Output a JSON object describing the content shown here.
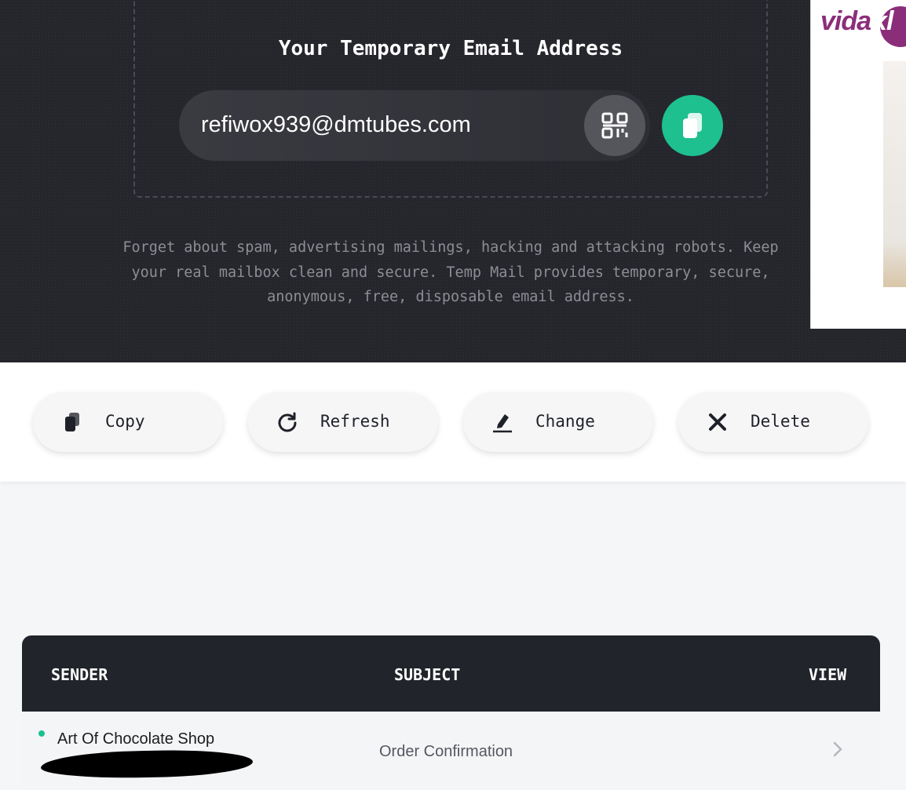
{
  "hero": {
    "title": "Your Temporary Email Address",
    "email": "refiwox939@dmtubes.com",
    "description": "Forget about spam, advertising mailings, hacking and attacking robots. Keep your real mailbox clean and secure. Temp Mail provides temporary, secure, anonymous, free, disposable email address."
  },
  "ad": {
    "brand": "vidaxl"
  },
  "actions": [
    {
      "label": "Copy",
      "icon": "copy-icon"
    },
    {
      "label": "Refresh",
      "icon": "refresh-icon"
    },
    {
      "label": "Change",
      "icon": "edit-icon"
    },
    {
      "label": "Delete",
      "icon": "close-icon"
    }
  ],
  "inbox": {
    "headers": {
      "sender": "SENDER",
      "subject": "SUBJECT",
      "view": "VIEW"
    },
    "rows": [
      {
        "sender": "Art Of Chocolate Shop",
        "subject": "Order Confirmation",
        "unread": true
      }
    ]
  },
  "colors": {
    "accent": "#1ec08f",
    "dark_bg": "#25252c",
    "table_header": "#22242b"
  }
}
